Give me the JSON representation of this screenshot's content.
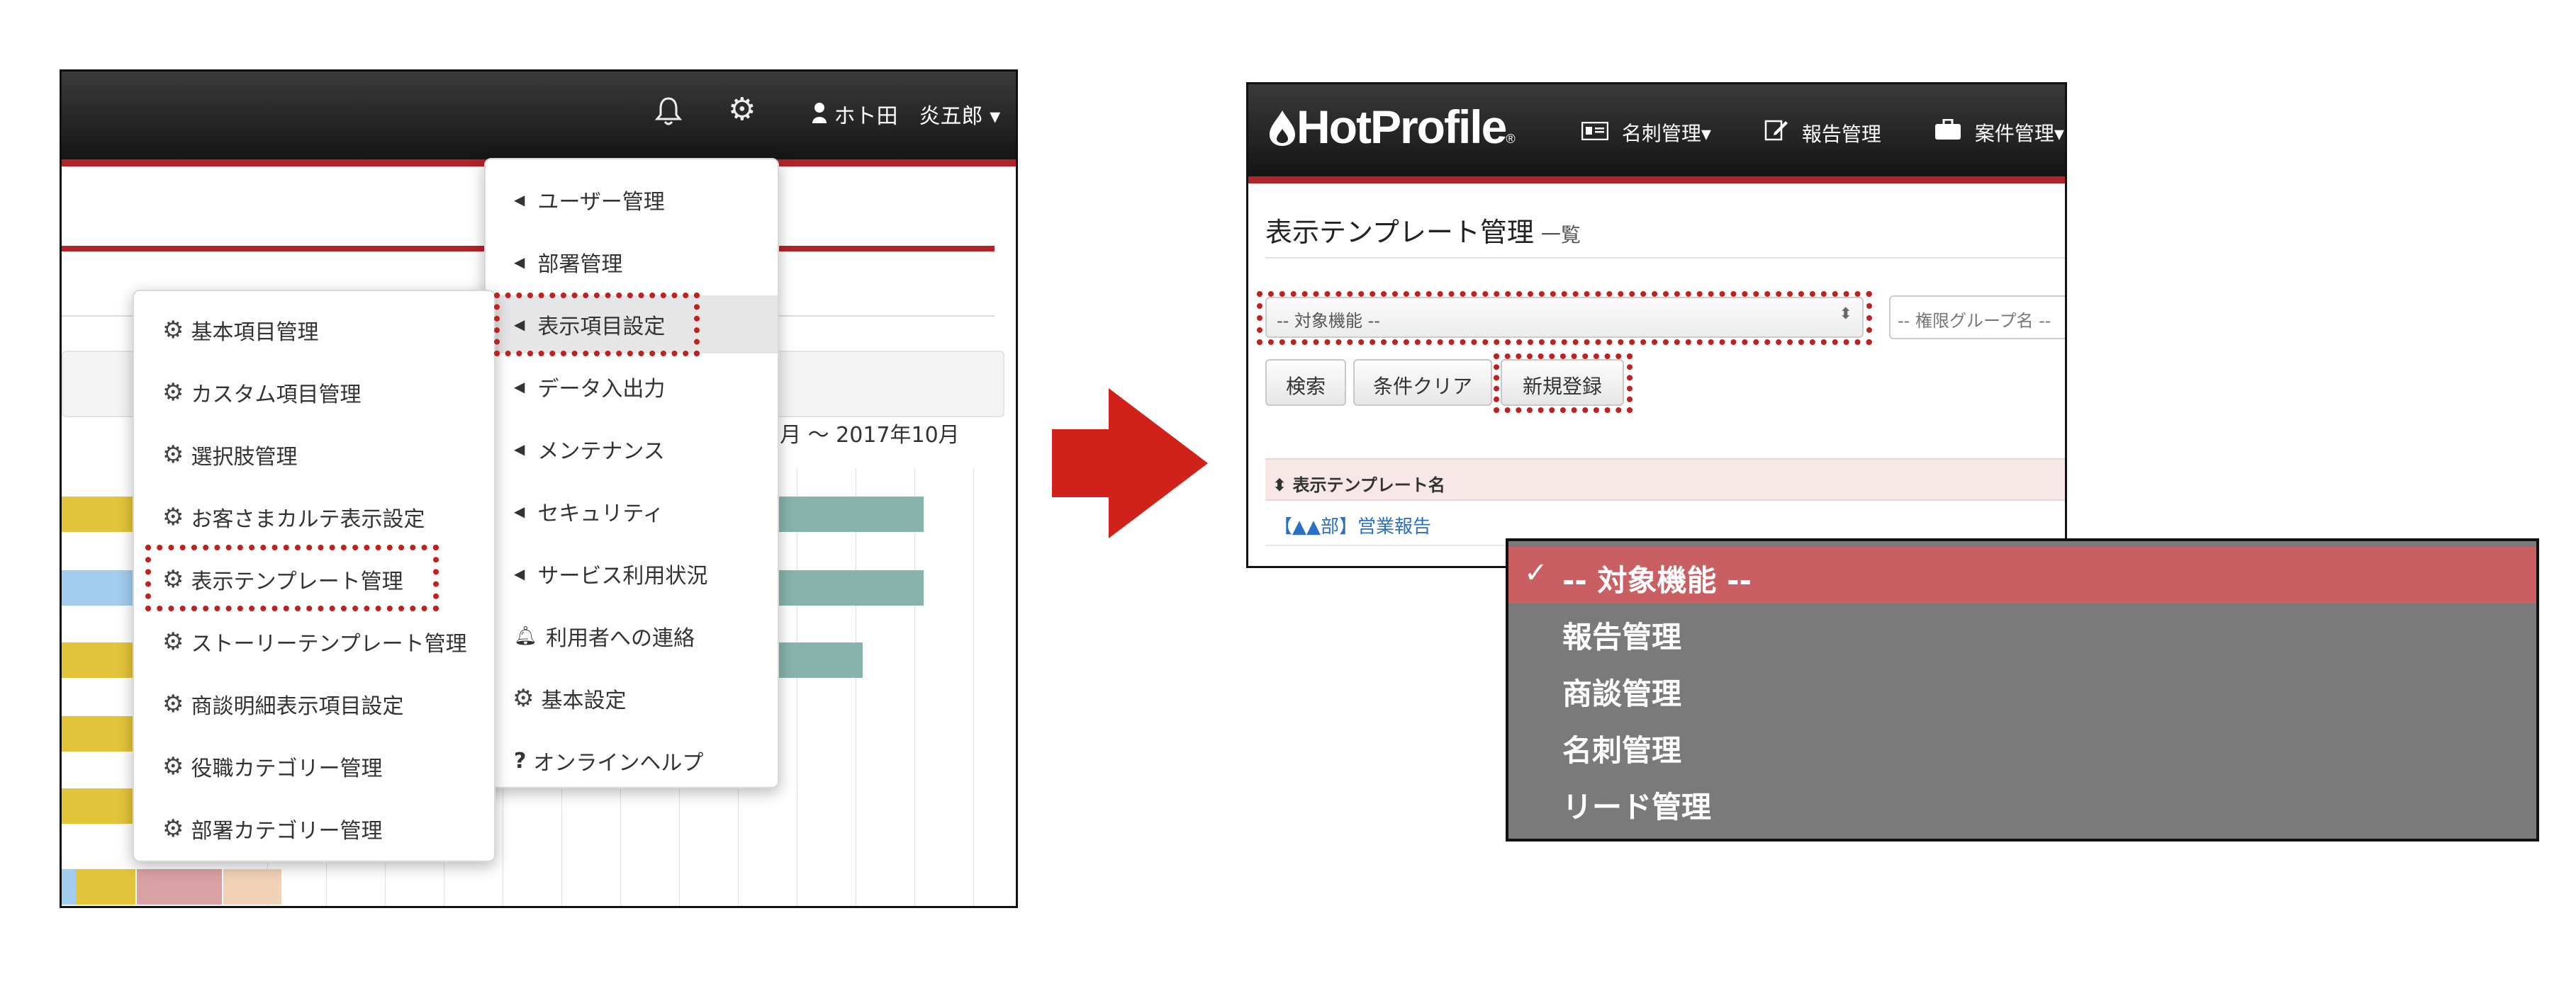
{
  "left_panel": {
    "header": {
      "notification_icon": "bell-icon",
      "settings_icon": "gear-icon",
      "user_icon": "user-icon",
      "user_name": "ホト田　炎五郎",
      "user_caret": "▾"
    },
    "period_text": "1月 〜 2017年10月",
    "settings_menu": [
      {
        "label": "ユーザー管理",
        "icon": "caret-left-icon"
      },
      {
        "label": "部署管理",
        "icon": "caret-left-icon"
      },
      {
        "label": "表示項目設定",
        "icon": "caret-left-icon",
        "highlighted": true
      },
      {
        "label": "データ入出力",
        "icon": "caret-left-icon"
      },
      {
        "label": "メンテナンス",
        "icon": "caret-left-icon"
      },
      {
        "label": "セキュリティ",
        "icon": "caret-left-icon"
      },
      {
        "label": "サービス利用状況",
        "icon": "caret-left-icon"
      },
      {
        "label": "利用者への連絡",
        "icon": "bell-icon"
      },
      {
        "label": "基本設定",
        "icon": "gear-icon"
      },
      {
        "label": "オンラインヘルプ",
        "icon": "question-icon"
      }
    ],
    "display_settings_submenu": [
      {
        "label": "基本項目管理",
        "icon": "gear-icon"
      },
      {
        "label": "カスタム項目管理",
        "icon": "gear-icon"
      },
      {
        "label": "選択肢管理",
        "icon": "gear-icon"
      },
      {
        "label": "お客さまカルテ表示設定",
        "icon": "gear-icon"
      },
      {
        "label": "表示テンプレート管理",
        "icon": "gear-icon",
        "highlighted": true
      },
      {
        "label": "ストーリーテンプレート管理",
        "icon": "gear-icon"
      },
      {
        "label": "商談明細表示項目設定",
        "icon": "gear-icon"
      },
      {
        "label": "役職カテゴリー管理",
        "icon": "gear-icon"
      },
      {
        "label": "部署カテゴリー管理",
        "icon": "gear-icon"
      }
    ],
    "chart_colors": {
      "yellow": "#e4c43a",
      "teal": "#88b3ad",
      "light_blue": "#a3cdee",
      "pink": "#d9a1a3",
      "peach": "#f1d2b6"
    }
  },
  "arrow": {
    "color": "#d0221b",
    "icon": "arrow-right-icon"
  },
  "right_panel": {
    "logo": "HotProfile",
    "logo_mark": "®",
    "nav": [
      {
        "label": "名刺管理",
        "icon": "card-icon",
        "caret": "▾"
      },
      {
        "label": "報告管理",
        "icon": "report-icon",
        "caret": ""
      },
      {
        "label": "案件管理",
        "icon": "briefcase-icon",
        "caret": "▾"
      }
    ],
    "page_title": "表示テンプレート管理",
    "page_subtitle": "一覧",
    "filter_select": {
      "value": "-- 対象機能 --",
      "arrows": "⬍"
    },
    "group_select": {
      "value": "-- 権限グループ名 --"
    },
    "buttons": {
      "search": "検索",
      "clear": "条件クリア",
      "new": "新規登録"
    },
    "table": {
      "sort_icon": "⬍",
      "column": "表示テンプレート名",
      "rows": [
        "【▲▲部】営業報告"
      ]
    }
  },
  "dropdown": {
    "check": "✓",
    "options": [
      {
        "label": "-- 対象機能 --",
        "selected": true
      },
      {
        "label": "報告管理",
        "selected": false
      },
      {
        "label": "商談管理",
        "selected": false
      },
      {
        "label": "名刺管理",
        "selected": false
      },
      {
        "label": "リード管理",
        "selected": false
      }
    ]
  }
}
